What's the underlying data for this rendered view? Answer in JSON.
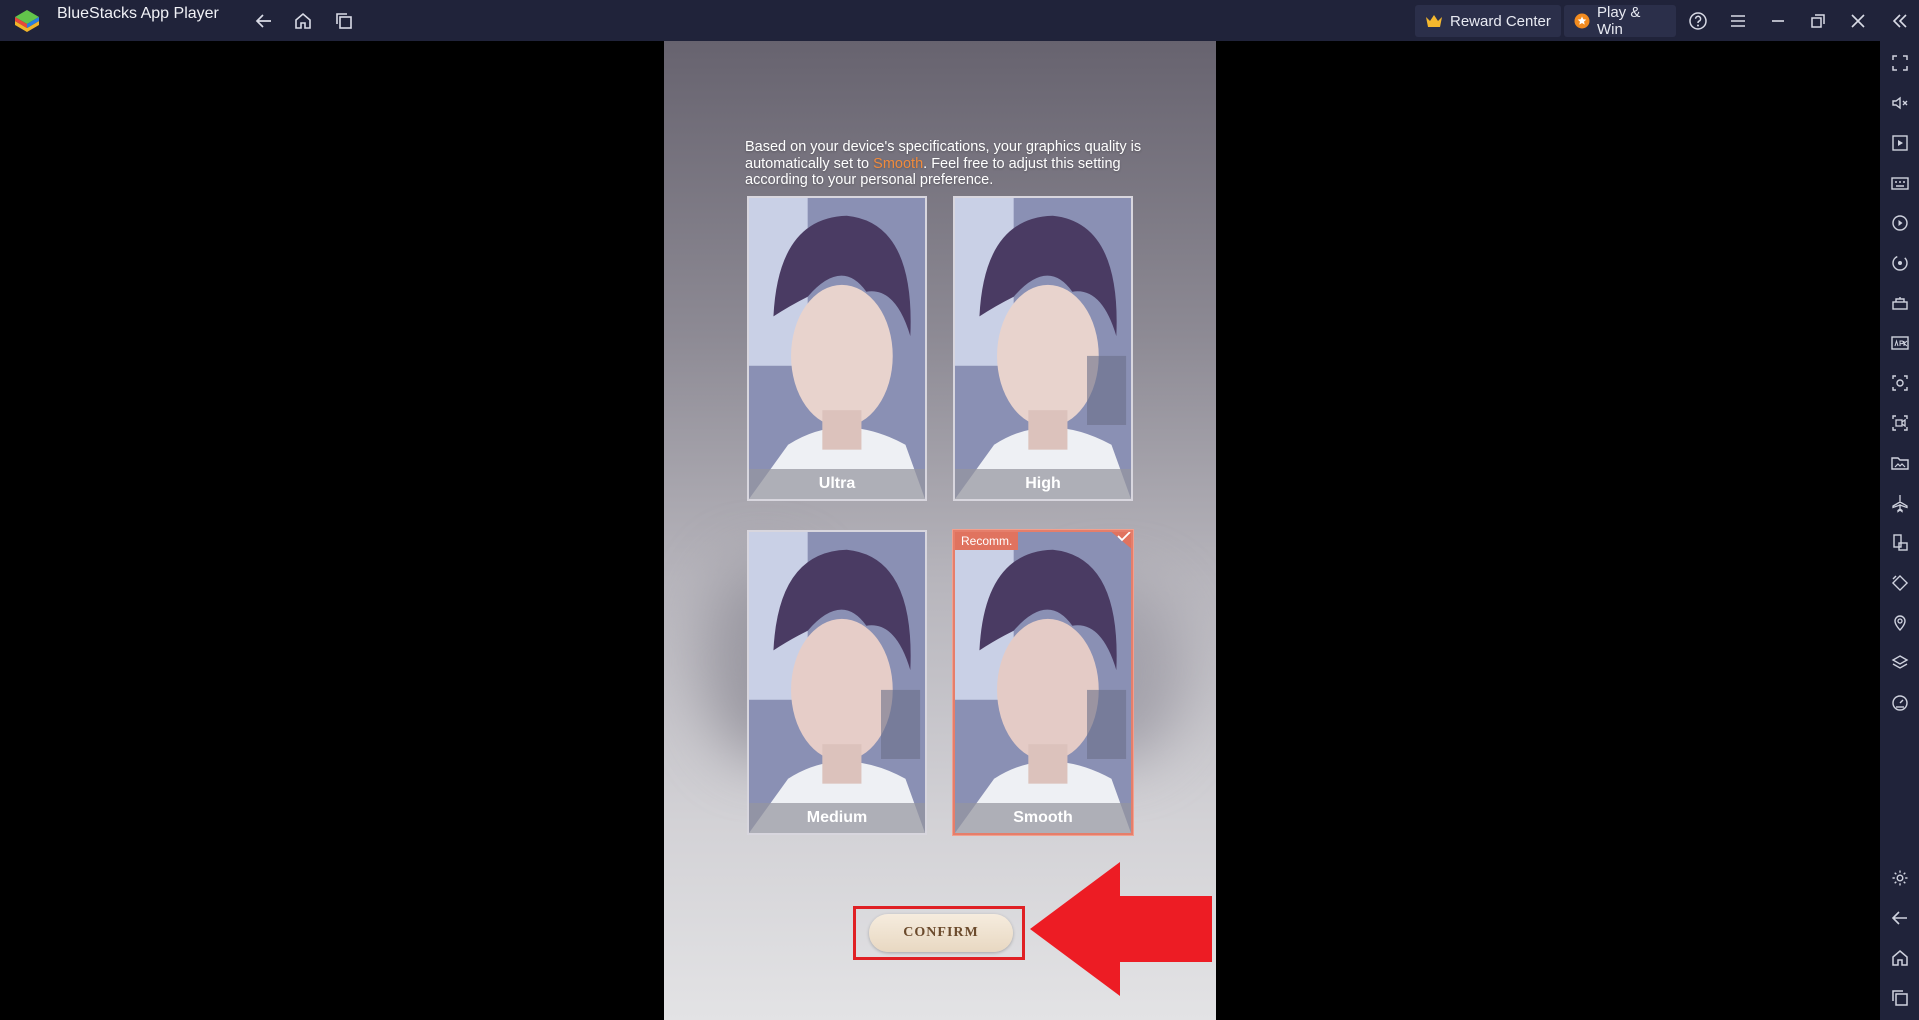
{
  "titlebar": {
    "app_title": "BlueStacks App Player",
    "reward_center": "Reward Center",
    "play_win": "Play & Win",
    "icons": [
      "back-icon",
      "home-icon",
      "multi-instance-icon",
      "help-icon",
      "menu-icon",
      "minimize-icon",
      "restore-icon",
      "close-icon",
      "collapse-sidebar-icon"
    ]
  },
  "sidebar": {
    "icons": [
      "fullscreen-icon",
      "volume-mute-icon",
      "screen-record-icon",
      "keyboard-icon",
      "macro-play-icon",
      "sync-icon",
      "performance-icon",
      "apk-install-icon",
      "screenshot-icon",
      "record-video-icon",
      "media-folder-icon",
      "airplane-mode-icon",
      "multi-device-icon",
      "rotate-icon",
      "location-icon",
      "layers-icon",
      "eco-mode-icon",
      "settings-icon",
      "back-icon",
      "home-icon",
      "recent-apps-icon"
    ]
  },
  "game": {
    "description_before": "Based on your device's specifications, your graphics quality is automatically set to ",
    "description_highlight": "Smooth",
    "description_after": ". Feel free to adjust this setting according to your personal preference.",
    "options": [
      {
        "label": "Ultra"
      },
      {
        "label": "High"
      },
      {
        "label": "Medium"
      },
      {
        "label": "Smooth",
        "badge": "Recomm."
      }
    ],
    "confirm_label": "CONFIRM"
  },
  "colors": {
    "chrome": "#20233a",
    "highlight": "#f08a3c",
    "selected_border": "#e57e6b",
    "annotation_red": "#e02024"
  }
}
